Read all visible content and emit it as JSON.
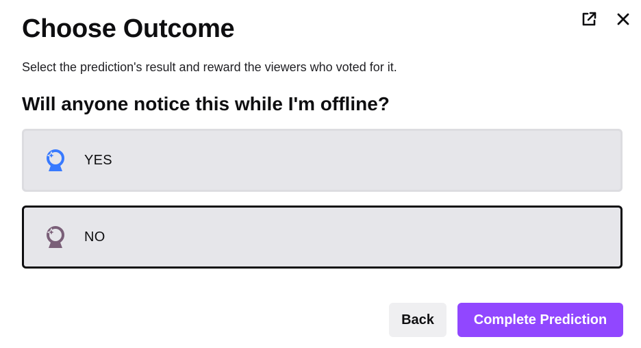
{
  "dialog": {
    "title": "Choose Outcome",
    "subtitle": "Select the prediction's result and reward the viewers who voted for it.",
    "question": "Will anyone notice this while I'm offline?",
    "header_icons": [
      "popout-icon",
      "close-icon"
    ]
  },
  "outcomes": [
    {
      "label": "YES",
      "icon": "prediction-icon",
      "color": "#387aff",
      "selected": false
    },
    {
      "label": "NO",
      "icon": "prediction-icon",
      "color": "#7a5f78",
      "selected": true
    }
  ],
  "footer": {
    "back_label": "Back",
    "complete_label": "Complete Prediction"
  },
  "colors": {
    "accent": "#9147ff",
    "yes_blue": "#387aff",
    "no_mauve": "#7a5f78"
  }
}
